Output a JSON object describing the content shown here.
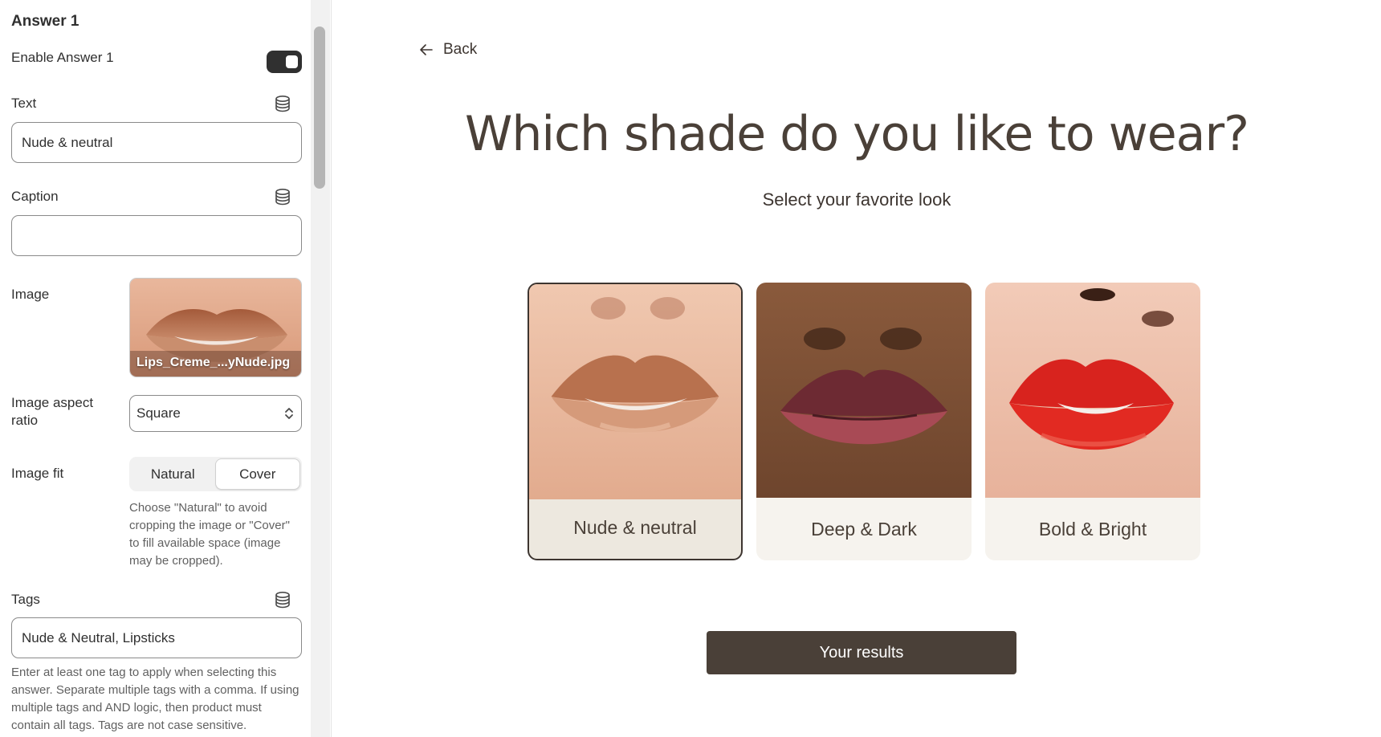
{
  "panel": {
    "section_title": "Answer 1",
    "enable_label": "Enable Answer 1",
    "enable_on": true,
    "text_label": "Text",
    "text_value": "Nude & neutral",
    "caption_label": "Caption",
    "caption_value": "",
    "image_label": "Image",
    "image_filename": "Lips_Creme_...yNude.jpg",
    "aspect_label": "Image aspect ratio",
    "aspect_value": "Square",
    "fit_label": "Image fit",
    "fit_options": [
      "Natural",
      "Cover"
    ],
    "fit_selected": "Cover",
    "fit_help": "Choose \"Natural\" to avoid cropping the image or \"Cover\" to fill available space (image may be cropped).",
    "tags_label": "Tags",
    "tags_value": "Nude & Neutral, Lipsticks",
    "tags_help": "Enter at least one tag to apply when selecting this answer. Separate multiple tags with a comma. If using multiple tags and AND logic, then product must contain all tags. Tags are not case sensitive.",
    "icons": {
      "dynamic_source": "database-icon",
      "select_arrows": "chevron-up-down-icon"
    }
  },
  "preview": {
    "back_label": "Back",
    "question": "Which shade do you like to wear?",
    "subtitle": "Select your favorite look",
    "answers": [
      {
        "label": "Nude & neutral",
        "selected": true
      },
      {
        "label": "Deep & Dark",
        "selected": false
      },
      {
        "label": "Bold & Bright",
        "selected": false
      }
    ],
    "results_label": "Your results"
  },
  "colors": {
    "primary_dark": "#4a4038",
    "selected_card_bg": "#ede8df",
    "card_bg": "#f6f3ee",
    "toggle_on": "#303030"
  }
}
